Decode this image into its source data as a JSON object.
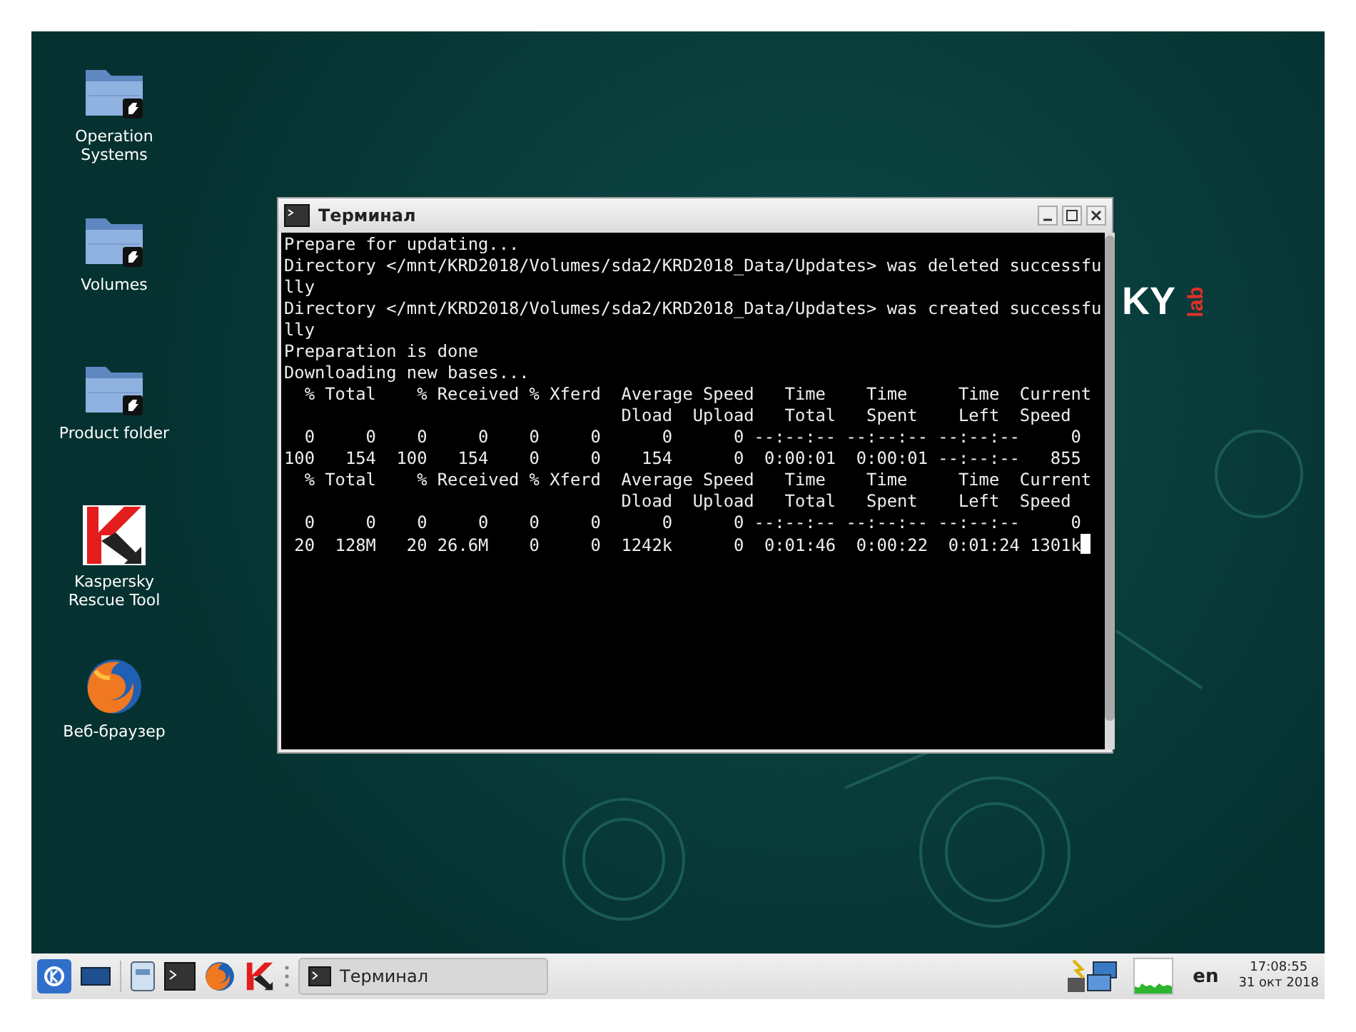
{
  "desktop": {
    "icons": [
      {
        "kind": "folder",
        "label": "Operation Systems"
      },
      {
        "kind": "folder",
        "label": "Volumes"
      },
      {
        "kind": "folder",
        "label": "Product folder"
      },
      {
        "kind": "kaspersky",
        "label": "Kaspersky Rescue Tool"
      },
      {
        "kind": "browser",
        "label": "Веб-браузер"
      }
    ],
    "logo": {
      "text": "KY",
      "sub": "lab"
    }
  },
  "terminal": {
    "title": "Терминал",
    "cursor": true,
    "lines": [
      "Prepare for updating...",
      "Directory </mnt/KRD2018/Volumes/sda2/KRD2018_Data/Updates> was deleted successfu",
      "lly",
      "Directory </mnt/KRD2018/Volumes/sda2/KRD2018_Data/Updates> was created successfu",
      "lly",
      "Preparation is done",
      "Downloading new bases...",
      "  % Total    % Received % Xferd  Average Speed   Time    Time     Time  Current",
      "                                 Dload  Upload   Total   Spent    Left  Speed",
      "  0     0    0     0    0     0      0      0 --:--:-- --:--:-- --:--:--     0",
      "100   154  100   154    0     0    154      0  0:00:01  0:00:01 --:--:--   855",
      "  % Total    % Received % Xferd  Average Speed   Time    Time     Time  Current",
      "                                 Dload  Upload   Total   Spent    Left  Speed",
      "  0     0    0     0    0     0      0      0 --:--:-- --:--:-- --:--:--     0",
      " 20  128M   20 26.6M    0     0  1242k      0  0:01:46  0:00:22  0:01:24 1301k"
    ]
  },
  "taskbar": {
    "task": {
      "label": "Терминал",
      "selected": false
    },
    "language": "en",
    "time": "17:08:55",
    "date": "31 окт 2018"
  }
}
